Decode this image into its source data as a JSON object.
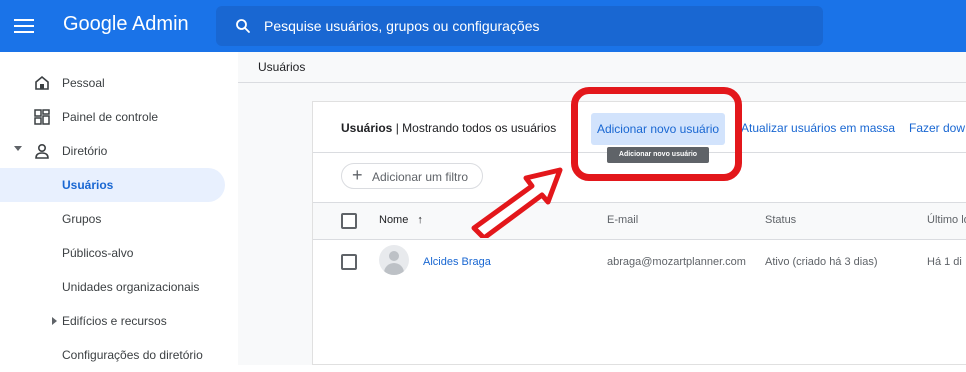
{
  "header": {
    "app_name": "Google Admin",
    "search_placeholder": "Pesquise usuários, grupos ou configurações"
  },
  "sidebar": {
    "items": [
      {
        "label": "Pessoal",
        "icon": "home-icon"
      },
      {
        "label": "Painel de controle",
        "icon": "dashboard-icon"
      },
      {
        "label": "Diretório",
        "icon": "person-icon"
      },
      {
        "label": "Usuários",
        "active": true
      },
      {
        "label": "Grupos"
      },
      {
        "label": "Públicos-alvo"
      },
      {
        "label": "Unidades organizacionais"
      },
      {
        "label": "Edifícios e recursos"
      },
      {
        "label": "Configurações do diretório"
      }
    ]
  },
  "main": {
    "breadcrumb": "Usuários",
    "panel_title_strong": "Usuários",
    "panel_title_rest": " | Mostrando todos os usuários",
    "add_user_label": "Adicionar novo usuário",
    "tooltip": "Adicionar novo usuário",
    "bulk_update_label": "Atualizar usuários em massa",
    "download_label": "Fazer dow",
    "filter_label": "Adicionar um filtro",
    "columns": [
      "Nome",
      "E-mail",
      "Status",
      "Último lo"
    ],
    "sort_arrow": "↑",
    "rows": [
      {
        "name": "Alcides Braga",
        "email": "abraga@mozartplanner.com",
        "status": "Ativo (criado há 3 dias)",
        "last_login": "Há 1 di"
      }
    ]
  },
  "colors": {
    "brand_blue": "#1a73e8",
    "highlight_red": "#e3171b"
  }
}
